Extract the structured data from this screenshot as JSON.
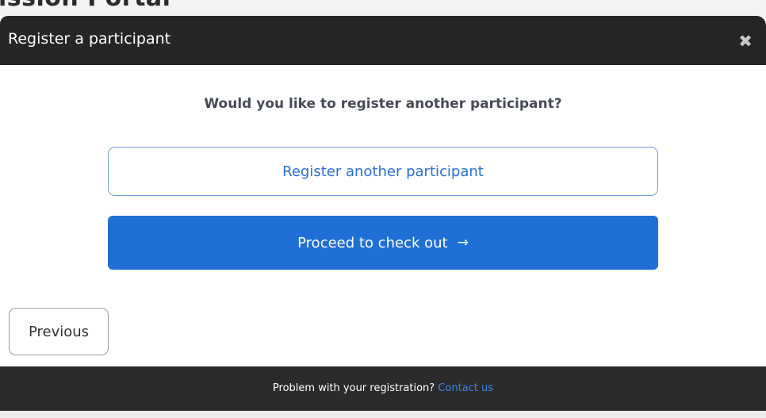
{
  "background": {
    "page_title_fragment": "ission Portal"
  },
  "modal": {
    "title": "Register a participant",
    "close_icon": "close-icon",
    "question": "Would you like to register another participant?",
    "register_another_label": "Register another participant",
    "checkout_label": "Proceed to check out",
    "checkout_arrow": "→",
    "previous_label": "Previous"
  },
  "footer": {
    "text": "Problem with your registration?",
    "link_text": "Contact us"
  },
  "colors": {
    "header_bg": "#262626",
    "primary": "#1f6fd4",
    "outline_border": "#6f9fdc",
    "link": "#3d86e6",
    "footer_bg": "#2b2b2b"
  }
}
